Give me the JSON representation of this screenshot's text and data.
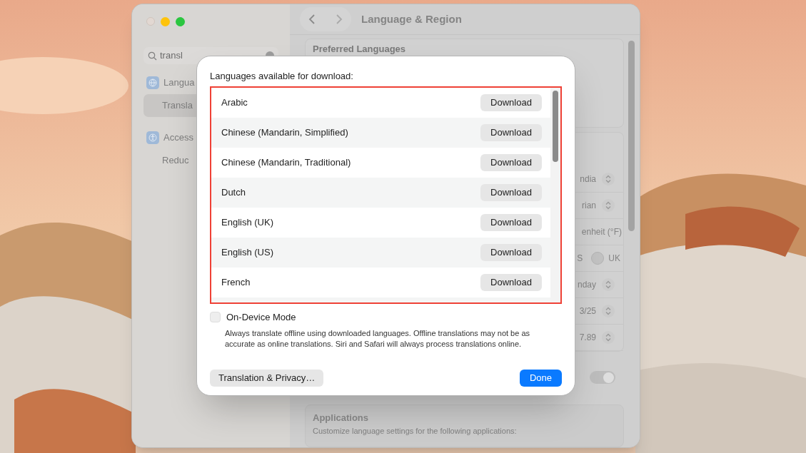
{
  "window": {
    "search": {
      "value": "transl"
    },
    "sidebar": {
      "items": [
        {
          "label": "Langua",
          "kind": "app",
          "selected": false
        },
        {
          "label": "Transla",
          "kind": "sub",
          "selected": true
        },
        {
          "label": "Access",
          "kind": "app",
          "selected": false
        },
        {
          "label": "Reduc",
          "kind": "sub",
          "selected": false
        }
      ]
    },
    "toolbar": {
      "title": "Language & Region"
    },
    "content": {
      "section_title": "Preferred Languages",
      "rows": [
        {
          "kind": "popup",
          "value": "ndia"
        },
        {
          "kind": "popup",
          "value": "rian"
        },
        {
          "kind": "text",
          "value": "enheit (°F)"
        },
        {
          "kind": "radio",
          "value": "S",
          "option": "UK",
          "selected": false
        },
        {
          "kind": "popup",
          "value": "nday"
        },
        {
          "kind": "popup",
          "value": "3/25"
        },
        {
          "kind": "popup",
          "value": "7.89"
        },
        {
          "kind": "toggle",
          "on": true
        }
      ]
    },
    "applications": {
      "title": "Applications",
      "description": "Customize language settings for the following applications:"
    }
  },
  "sheet": {
    "title": "Languages available for download:",
    "languages": [
      {
        "name": "Arabic",
        "action": "Download"
      },
      {
        "name": "Chinese (Mandarin, Simplified)",
        "action": "Download"
      },
      {
        "name": "Chinese (Mandarin, Traditional)",
        "action": "Download"
      },
      {
        "name": "Dutch",
        "action": "Download"
      },
      {
        "name": "English (UK)",
        "action": "Download"
      },
      {
        "name": "English (US)",
        "action": "Download"
      },
      {
        "name": "French",
        "action": "Download"
      }
    ],
    "on_device_mode": {
      "label": "On-Device Mode",
      "checked": false,
      "description": "Always translate offline using downloaded languages. Offline translations may not be as accurate as online translations. Siri and Safari will always process translations online."
    },
    "buttons": [
      {
        "label": "Translation & Privacy…",
        "kind": "secondary"
      },
      {
        "label": "Done",
        "kind": "primary"
      }
    ]
  }
}
